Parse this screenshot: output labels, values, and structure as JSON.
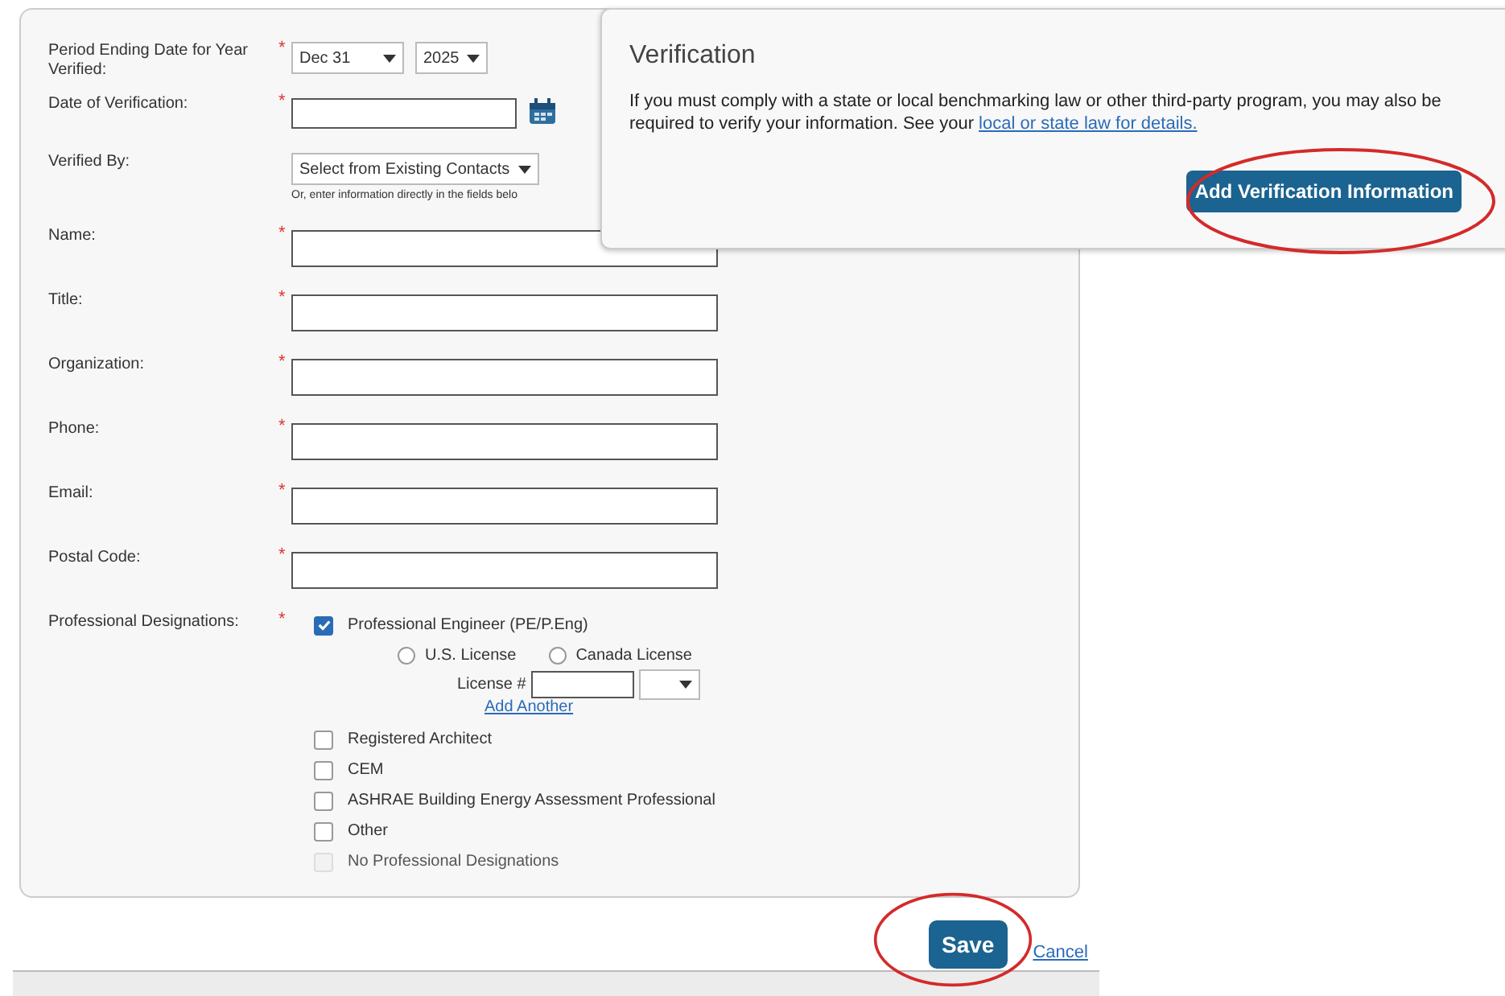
{
  "form": {
    "fields": [
      {
        "kind": "period",
        "label": "Period Ending Date for Year Verified:",
        "marker": "*",
        "day": "Dec 31",
        "year": "2025"
      },
      {
        "kind": "date",
        "label": "Date of Verification:",
        "marker": "*"
      },
      {
        "kind": "contacts",
        "label": "Verified By:",
        "value": "Select from Existing Contacts",
        "hint": "Or, enter information directly in the fields belo"
      },
      {
        "kind": "text",
        "label": "Name:",
        "marker": "*"
      },
      {
        "kind": "text",
        "label": "Title:",
        "marker": "*"
      },
      {
        "kind": "text",
        "label": "Organization:",
        "marker": "*"
      },
      {
        "kind": "text",
        "label": "Phone:",
        "marker": "*"
      },
      {
        "kind": "text",
        "label": "Email:",
        "marker": "*"
      },
      {
        "kind": "text",
        "label": "Postal Code:",
        "marker": "*"
      }
    ],
    "designations": {
      "label": "Professional Designations:",
      "marker": "*",
      "options": [
        {
          "label": "Professional Engineer (PE/P.Eng)",
          "checked": true,
          "disabled": false,
          "licenses": [
            {
              "label": "U.S. License",
              "selected": false
            },
            {
              "label": "Canada License",
              "selected": false
            }
          ],
          "license_label": "License #",
          "add_link": "Add Another"
        },
        {
          "label": "Registered Architect",
          "checked": false,
          "disabled": false
        },
        {
          "label": "CEM",
          "checked": false,
          "disabled": false
        },
        {
          "label": "ASHRAE Building Energy Assessment Professional",
          "checked": false,
          "disabled": false
        },
        {
          "label": "Other",
          "checked": false,
          "disabled": false
        },
        {
          "label": "No Professional Designations",
          "checked": false,
          "disabled": true
        }
      ]
    }
  },
  "actions": {
    "save": "Save",
    "cancel": "Cancel"
  },
  "dialog": {
    "title": "Verification",
    "text": "If you must comply with a state or local benchmarking law or other third-party program, you may also be required to verify your information. See your ",
    "link": "local or state law for details.",
    "button": "Add Verification Information"
  }
}
